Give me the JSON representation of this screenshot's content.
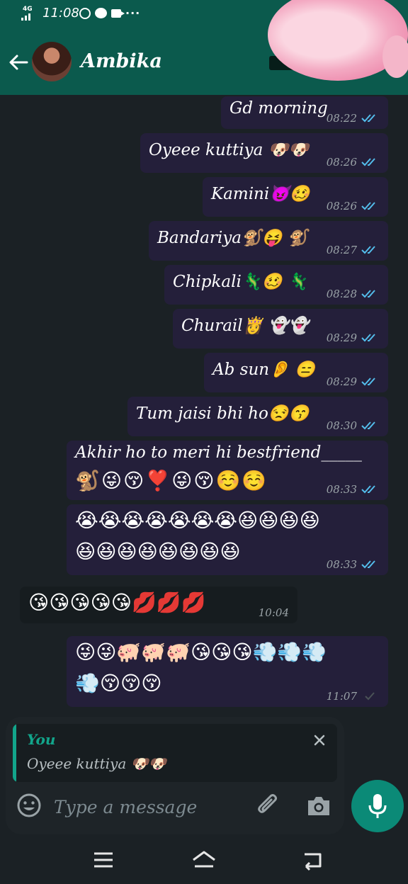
{
  "status": {
    "network": "4G",
    "time": "11:08"
  },
  "header": {
    "contact_name": "Ambika"
  },
  "messages": [
    {
      "dir": "out",
      "text": "Gd morning",
      "time": "08:22",
      "read": true
    },
    {
      "dir": "out",
      "text": "Oyeee kuttiya 🐶🐶",
      "time": "08:26",
      "read": true
    },
    {
      "dir": "out",
      "text": "Kamini😈🥴",
      "time": "08:26",
      "read": true
    },
    {
      "dir": "out",
      "text": "Bandariya🐒😝 🐒",
      "time": "08:27",
      "read": true
    },
    {
      "dir": "out",
      "text": "Chipkali🦎🥴 🦎",
      "time": "08:28",
      "read": true
    },
    {
      "dir": "out",
      "text": "Churail👸 👻👻",
      "time": "08:29",
      "read": true
    },
    {
      "dir": "out",
      "text": "Ab sun👂 😑",
      "time": "08:29",
      "read": true
    },
    {
      "dir": "out",
      "text": "Tum jaisi  bhi ho😒😙",
      "time": "08:30",
      "read": true
    },
    {
      "dir": "out",
      "text": "Akhir ho to meri  hi bestfriend_____",
      "text2": "🐒😜😚❣️😜😚☺️☺️",
      "time": "08:33",
      "read": true
    },
    {
      "dir": "out",
      "text": "😭😭😭😭😭😭😭😆😆😆😆",
      "text2": "😆😆😆😆😆😆😆😆",
      "time": "08:33",
      "read": true
    },
    {
      "dir": "in",
      "text": "😘😘😘😘😘💋💋💋",
      "time": "10:04"
    },
    {
      "dir": "out",
      "text": "😜😜🐖🐖🐖😘😘😘💨💨💨",
      "text2": "💨😚😚😚",
      "time": "11:07",
      "read": false
    }
  ],
  "reply": {
    "author": "You",
    "text": "Oyeee kuttiya 🐶🐶"
  },
  "composer": {
    "placeholder": "Type a message"
  },
  "colors": {
    "header_bg": "#0b5a4d",
    "accent": "#12a58b",
    "read_tick": "#53bdeb",
    "out_bubble": "#241f3a"
  }
}
